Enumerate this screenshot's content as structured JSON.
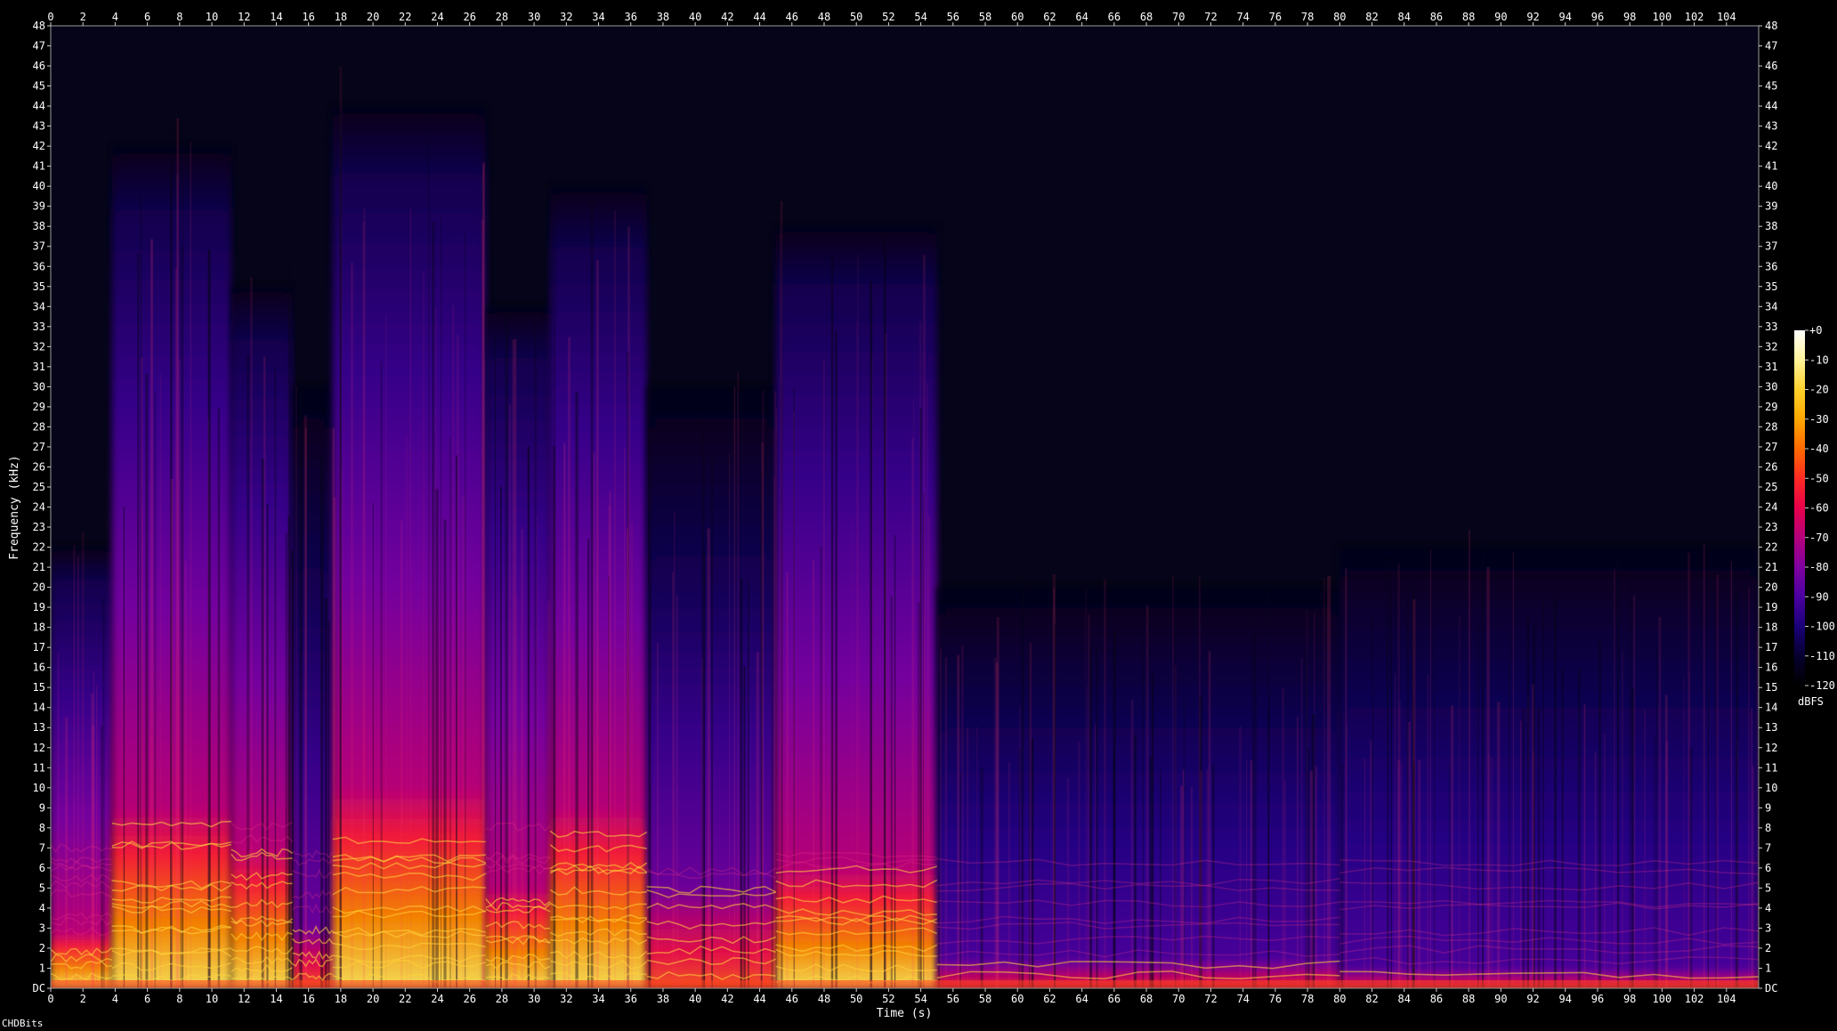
{
  "footer": {
    "label": "CHDBits"
  },
  "chart_data": {
    "type": "heatmap",
    "title": "",
    "xlabel": "Time (s)",
    "ylabel": "Frequency (kHz)",
    "xlim": [
      0,
      106
    ],
    "ylim": [
      0,
      48
    ],
    "x_ticks": [
      "0",
      "2",
      "4",
      "6",
      "8",
      "10",
      "12",
      "14",
      "16",
      "18",
      "20",
      "22",
      "24",
      "26",
      "28",
      "30",
      "32",
      "34",
      "36",
      "38",
      "40",
      "42",
      "44",
      "46",
      "48",
      "50",
      "52",
      "54",
      "56",
      "58",
      "60",
      "62",
      "64",
      "66",
      "68",
      "70",
      "72",
      "74",
      "76",
      "78",
      "80",
      "82",
      "84",
      "86",
      "88",
      "90",
      "92",
      "94",
      "96",
      "98",
      "100",
      "102",
      "104"
    ],
    "y_ticks": [
      "DC",
      "1",
      "2",
      "3",
      "4",
      "5",
      "6",
      "7",
      "8",
      "9",
      "10",
      "11",
      "12",
      "13",
      "14",
      "15",
      "16",
      "17",
      "18",
      "19",
      "20",
      "21",
      "22",
      "23",
      "24",
      "25",
      "26",
      "27",
      "28",
      "29",
      "30",
      "31",
      "32",
      "33",
      "34",
      "35",
      "36",
      "37",
      "38",
      "39",
      "40",
      "41",
      "42",
      "43",
      "44",
      "45",
      "46",
      "47",
      "48"
    ],
    "colorbar": {
      "unit": "dBFS",
      "ticks": [
        "+0",
        "-10",
        "-20",
        "-30",
        "-40",
        "-50",
        "-60",
        "-70",
        "-80",
        "-90",
        "-100",
        "-110",
        "-120"
      ],
      "colors": [
        "#ffffff",
        "#fff39a",
        "#ffd12b",
        "#ffa800",
        "#ff6a00",
        "#ff2a24",
        "#e8004a",
        "#b4007c",
        "#8000a0",
        "#4b00a2",
        "#1a0078",
        "#060030",
        "#000000"
      ]
    },
    "segments": [
      {
        "t_start": 0,
        "t_end": 3.8,
        "bright_top_khz": 2.8,
        "energy_top_khz": 22,
        "level": "high"
      },
      {
        "t_start": 3.8,
        "t_end": 11.2,
        "bright_top_khz": 9,
        "energy_top_khz": 42,
        "level": "high"
      },
      {
        "t_start": 11.2,
        "t_end": 15,
        "bright_top_khz": 7,
        "energy_top_khz": 35,
        "level": "high"
      },
      {
        "t_start": 15,
        "t_end": 17.5,
        "bright_top_khz": 3,
        "energy_top_khz": 30,
        "level": "medium"
      },
      {
        "t_start": 17.5,
        "t_end": 27,
        "bright_top_khz": 10,
        "energy_top_khz": 44,
        "level": "high"
      },
      {
        "t_start": 27,
        "t_end": 31,
        "bright_top_khz": 5,
        "energy_top_khz": 34,
        "level": "high"
      },
      {
        "t_start": 31,
        "t_end": 37,
        "bright_top_khz": 9,
        "energy_top_khz": 40,
        "level": "high"
      },
      {
        "t_start": 37,
        "t_end": 45,
        "bright_top_khz": 5,
        "energy_top_khz": 30,
        "level": "medium"
      },
      {
        "t_start": 45,
        "t_end": 55,
        "bright_top_khz": 6,
        "energy_top_khz": 38,
        "level": "high"
      },
      {
        "t_start": 55,
        "t_end": 80,
        "bright_top_khz": 1.5,
        "energy_top_khz": 20,
        "level": "low"
      },
      {
        "t_start": 80,
        "t_end": 106,
        "bright_top_khz": 1,
        "energy_top_khz": 22,
        "level": "low"
      }
    ]
  }
}
